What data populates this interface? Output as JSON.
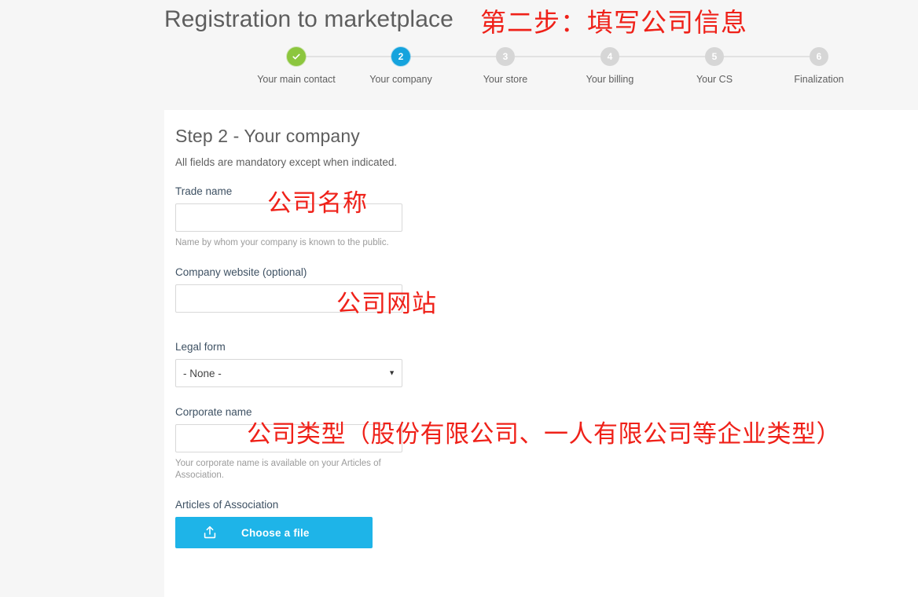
{
  "header": {
    "title": "Registration to marketplace"
  },
  "annotations": {
    "top": "第二步：填写公司信息",
    "trade_name": "公司名称",
    "company_website": "公司网站",
    "legal_form": "公司类型（股份有限公司、一人有限公司等企业类型）",
    "color": "#ef2119"
  },
  "stepper": {
    "steps": [
      {
        "number": "1",
        "label": "Your main contact",
        "state": "done",
        "icon": "check-icon"
      },
      {
        "number": "2",
        "label": "Your company",
        "state": "active"
      },
      {
        "number": "3",
        "label": "Your store",
        "state": "todo"
      },
      {
        "number": "4",
        "label": "Your billing",
        "state": "todo"
      },
      {
        "number": "5",
        "label": "Your CS",
        "state": "todo"
      },
      {
        "number": "6",
        "label": "Finalization",
        "state": "todo"
      }
    ],
    "colors": {
      "done": "#8cc63e",
      "active": "#15a3dd",
      "todo": "#d6d6d6",
      "line": "#e2e2e2"
    }
  },
  "form": {
    "title": "Step 2 - Your company",
    "subtitle": "All fields are mandatory except when indicated.",
    "fields": {
      "trade_name": {
        "label": "Trade name",
        "value": "",
        "placeholder": "",
        "help": "Name by whom your company is known to the public."
      },
      "company_website": {
        "label": "Company website (optional)",
        "value": "",
        "placeholder": ""
      },
      "legal_form": {
        "label": "Legal form",
        "selected": "- None -",
        "options": [
          "- None -"
        ],
        "caret_icon": "chevron-down-icon"
      },
      "corporate_name": {
        "label": "Corporate name",
        "value": "",
        "placeholder": "",
        "help": "Your corporate name is available on your Articles of Association."
      },
      "articles_of_association": {
        "label": "Articles of Association",
        "button_label": "Choose a file",
        "button_icon": "upload-icon",
        "button_color": "#1eb4e8"
      }
    }
  }
}
